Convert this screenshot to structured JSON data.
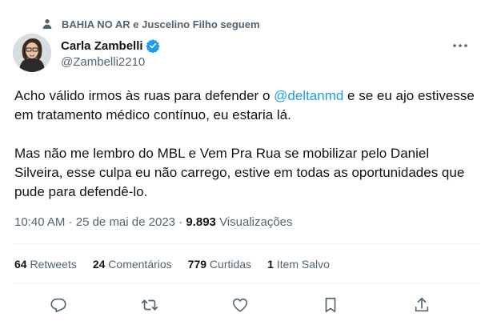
{
  "social_context": "BAHIA NO AR e Juscelino Filho seguem",
  "author": {
    "name": "Carla Zambelli",
    "handle": "@Zambelli2210"
  },
  "tweet": {
    "p1_before": "Acho válido irmos às ruas para defender o ",
    "p1_mention": "@deltanmd",
    "p1_after": " e se eu ajo estivesse em tratamento médico contínuo, eu estaria lá.",
    "p2": "Mas não me lembro do MBL e Vem Pra Rua se mobilizar pelo Daniel Silveira, esse culpa eu não carrego, estive em todas as oportunidades que pude para defendê-lo."
  },
  "meta": {
    "time": "10:40 AM",
    "sep": " · ",
    "date": "25 de mai de 2023",
    "views_count": "9.893",
    "views_label": "Visualizações"
  },
  "stats": {
    "retweets_count": "64",
    "retweets_label": "Retweets",
    "comments_count": "24",
    "comments_label": "Comentários",
    "likes_count": "779",
    "likes_label": "Curtidas",
    "saves_count": "1",
    "saves_label": "Item Salvo"
  },
  "icons": {
    "social": "person-icon",
    "verified": "verified-badge-icon",
    "more": "more-icon",
    "reply": "reply-icon",
    "retweet": "retweet-icon",
    "like": "heart-icon",
    "bookmark": "bookmark-icon",
    "share": "share-icon"
  },
  "colors": {
    "accent": "#1d9bf0",
    "secondary_text": "#536471",
    "primary_text": "#0f1419"
  }
}
